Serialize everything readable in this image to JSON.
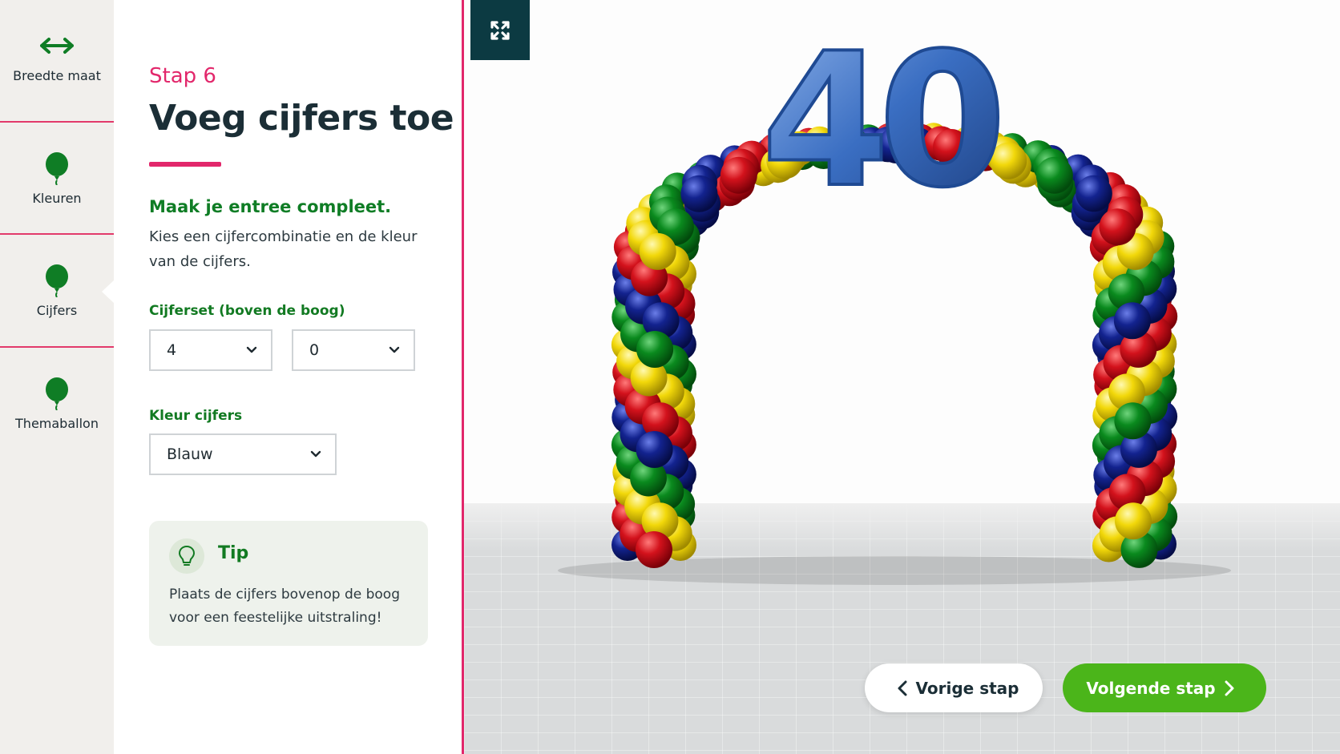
{
  "sidebar": {
    "items": [
      {
        "label": "Breedte maat",
        "icon": "width-arrows-icon"
      },
      {
        "label": "Kleuren",
        "icon": "balloon-icon"
      },
      {
        "label": "Cijfers",
        "icon": "balloon-icon",
        "active": true
      },
      {
        "label": "Themaballon",
        "icon": "balloon-icon"
      }
    ]
  },
  "step": {
    "label": "Stap 6",
    "title": "Voeg cijfers toe",
    "lead": "Maak je entree compleet.",
    "description": "Kies een cijfercombinatie en de kleur van de cijfers."
  },
  "fields": {
    "digit_set_label": "Cijferset (boven de boog)",
    "digit1": "4",
    "digit2": "0",
    "color_label": "Kleur cijfers",
    "color": "Blauw"
  },
  "tip": {
    "title": "Tip",
    "text": "Plaats de cijfers bovenop de boog voor een feestelijke uitstraling!"
  },
  "preview": {
    "numbers": "40",
    "balloon_colors": [
      "#d3121c",
      "#f2d80a",
      "#0a8a1e",
      "#13238f"
    ],
    "number_color": "#3a6ec2"
  },
  "navigation": {
    "prev_label": "Vorige stap",
    "next_label": "Volgende stap"
  },
  "colors": {
    "brand_pink": "#e2276b",
    "brand_green": "#127a22",
    "button_green": "#4bb51a",
    "dark_teal": "#0c3a42"
  }
}
